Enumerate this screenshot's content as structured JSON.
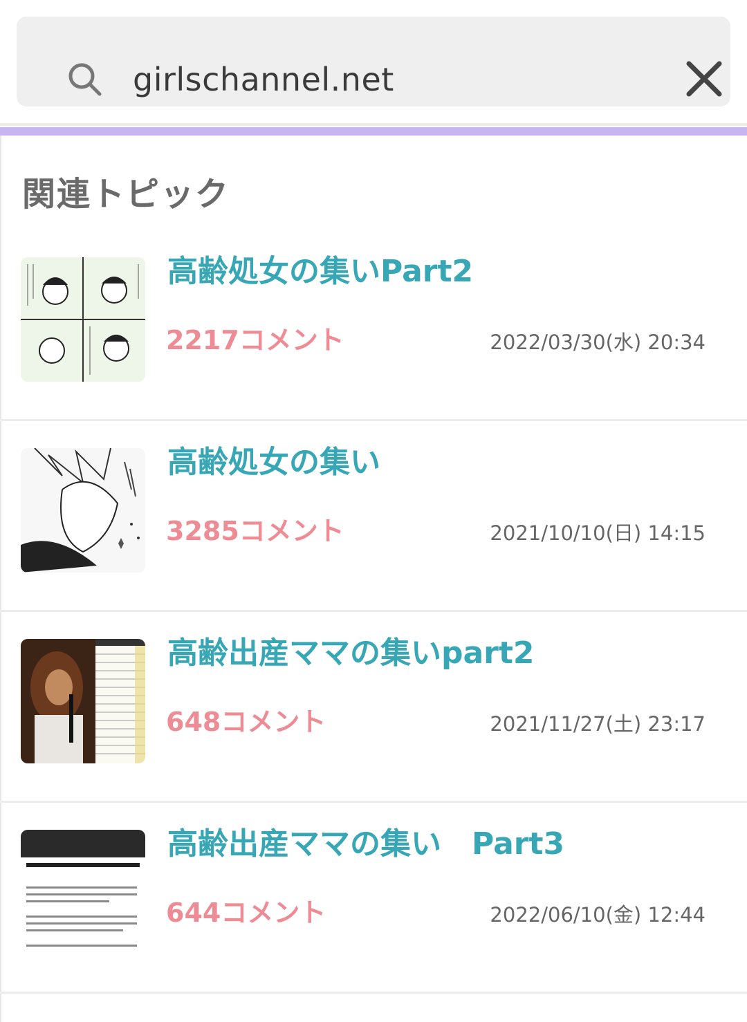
{
  "search": {
    "query": "girlschannel.net",
    "search_icon": "search-icon",
    "clear_icon": "close-icon"
  },
  "colors": {
    "accent_bar": "#c9b4f2",
    "title": "#37a7b5",
    "comments": "#ee8c95",
    "date": "#666666"
  },
  "section": {
    "title": "関連トピック"
  },
  "topics": [
    {
      "title": "高齢処女の集いPart2",
      "comments": "2217コメント",
      "date": "2022/03/30(水) 20:34"
    },
    {
      "title": "高齢処女の集い",
      "comments": "3285コメント",
      "date": "2021/10/10(日) 14:15"
    },
    {
      "title": "高齢出産ママの集いpart2",
      "comments": "648コメント",
      "date": "2021/11/27(土) 23:17"
    },
    {
      "title": "高齢出産ママの集い　Part3",
      "comments": "644コメント",
      "date": "2022/06/10(金) 12:44"
    }
  ]
}
